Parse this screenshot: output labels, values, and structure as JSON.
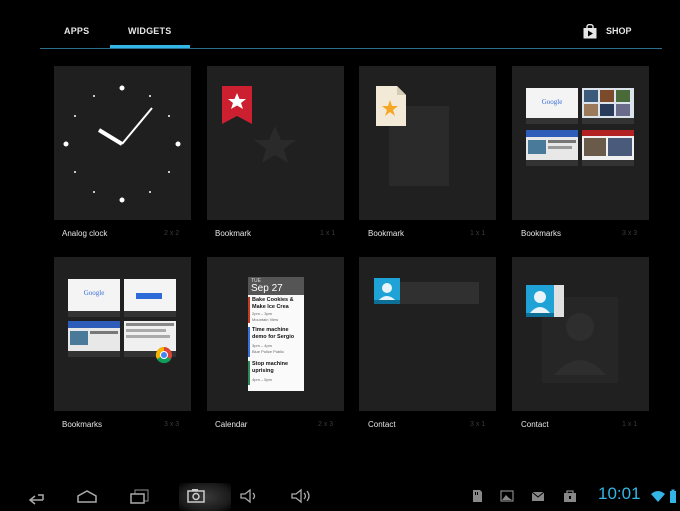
{
  "tabs": {
    "apps": "APPS",
    "widgets": "WIDGETS",
    "shop": "SHOP"
  },
  "widgets": [
    {
      "name": "Analog clock",
      "dims": "2 x 2"
    },
    {
      "name": "Bookmark",
      "dims": "1 x 1"
    },
    {
      "name": "Bookmark",
      "dims": "1 x 1"
    },
    {
      "name": "Bookmarks",
      "dims": "3 x 3"
    },
    {
      "name": "Bookmarks",
      "dims": "3 x 3"
    },
    {
      "name": "Calendar",
      "dims": "2 x 3"
    },
    {
      "name": "Contact",
      "dims": "3 x 1"
    },
    {
      "name": "Contact",
      "dims": "1 x 1"
    }
  ],
  "preview": {
    "google": "Google",
    "pictures_label": "Picasa",
    "gmail_label": "Gmail",
    "calendar_day": "TUE",
    "calendar_date": "Sep 27",
    "events": [
      {
        "title": "Bake Cookies & Make Ice Crea",
        "time": "2pm – 3pm",
        "place": "Mountain View"
      },
      {
        "title": "Time machine demo for Sergio",
        "time": "3pm – 4pm",
        "place": "Blue Police Public"
      },
      {
        "title": "Stop machine uprising",
        "time": "4pm – 5pm",
        "place": ""
      }
    ]
  },
  "status": {
    "time": "10:01"
  },
  "colors": {
    "accent": "#33b5e5",
    "bookmark_red": "#cc1f2f",
    "background": "#000000"
  }
}
